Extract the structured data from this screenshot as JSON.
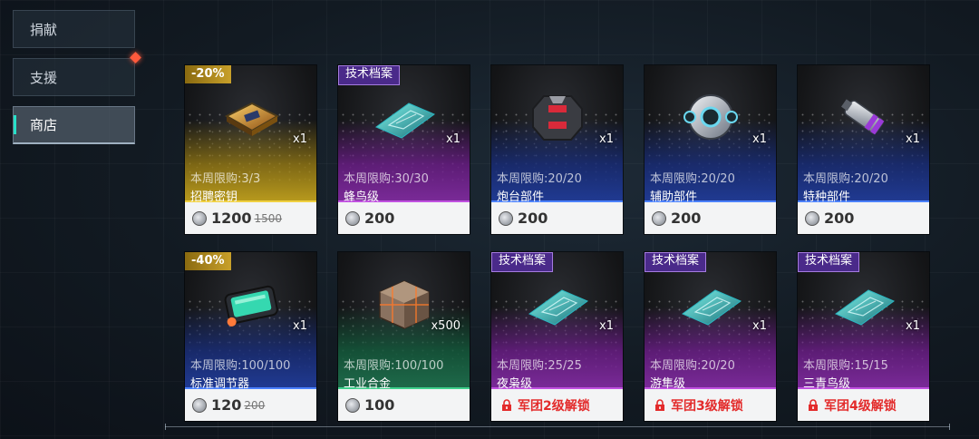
{
  "nav": {
    "items": [
      {
        "label": "捐献"
      },
      {
        "label": "支援"
      },
      {
        "label": "商店"
      }
    ]
  },
  "shop": {
    "items": [
      {
        "tag": "-20%",
        "tag_type": "discount",
        "qty": "x1",
        "limit": "本周限购:3/3",
        "name": "招聘密钥",
        "price": "1200",
        "old_price": "1500",
        "rarity": "gold",
        "icon": "key-box-icon"
      },
      {
        "tag": "技术档案",
        "tag_type": "tech",
        "qty": "x1",
        "limit": "本周限购:30/30",
        "name": "蜂鸟级",
        "price": "200",
        "old_price": "",
        "rarity": "purple",
        "icon": "blueprint-icon"
      },
      {
        "tag": "",
        "tag_type": "",
        "qty": "x1",
        "limit": "本周限购:20/20",
        "name": "炮台部件",
        "price": "200",
        "old_price": "",
        "rarity": "blue",
        "icon": "turret-part-icon"
      },
      {
        "tag": "",
        "tag_type": "",
        "qty": "x1",
        "limit": "本周限购:20/20",
        "name": "辅助部件",
        "price": "200",
        "old_price": "",
        "rarity": "blue",
        "icon": "support-part-icon"
      },
      {
        "tag": "",
        "tag_type": "",
        "qty": "x1",
        "limit": "本周限购:20/20",
        "name": "特种部件",
        "price": "200",
        "old_price": "",
        "rarity": "blue",
        "icon": "special-part-icon"
      },
      {
        "tag": "-40%",
        "tag_type": "discount",
        "qty": "x1",
        "limit": "本周限购:100/100",
        "name": "标准调节器",
        "price": "120",
        "old_price": "200",
        "rarity": "blue",
        "icon": "regulator-icon"
      },
      {
        "tag": "",
        "tag_type": "",
        "qty": "x500",
        "limit": "本周限购:100/100",
        "name": "工业合金",
        "price": "100",
        "old_price": "",
        "rarity": "green",
        "icon": "alloy-cube-icon"
      },
      {
        "tag": "技术档案",
        "tag_type": "tech",
        "qty": "x1",
        "limit": "本周限购:25/25",
        "name": "夜枭级",
        "price": "",
        "old_price": "",
        "lock_text": "军团2级解锁",
        "rarity": "purple",
        "icon": "blueprint-icon"
      },
      {
        "tag": "技术档案",
        "tag_type": "tech",
        "qty": "x1",
        "limit": "本周限购:20/20",
        "name": "游隼级",
        "price": "",
        "old_price": "",
        "lock_text": "军团3级解锁",
        "rarity": "purple",
        "icon": "blueprint-icon"
      },
      {
        "tag": "技术档案",
        "tag_type": "tech",
        "qty": "x1",
        "limit": "本周限购:15/15",
        "name": "三青鸟级",
        "price": "",
        "old_price": "",
        "lock_text": "军团4级解锁",
        "rarity": "purple",
        "icon": "blueprint-icon"
      }
    ]
  },
  "colors": {
    "accent": "#27e0c8",
    "lock": "#e32b2b",
    "gold": "#b89a1d",
    "purple": "#7a2a98",
    "blue": "#203a92",
    "green": "#1e6a4a"
  }
}
